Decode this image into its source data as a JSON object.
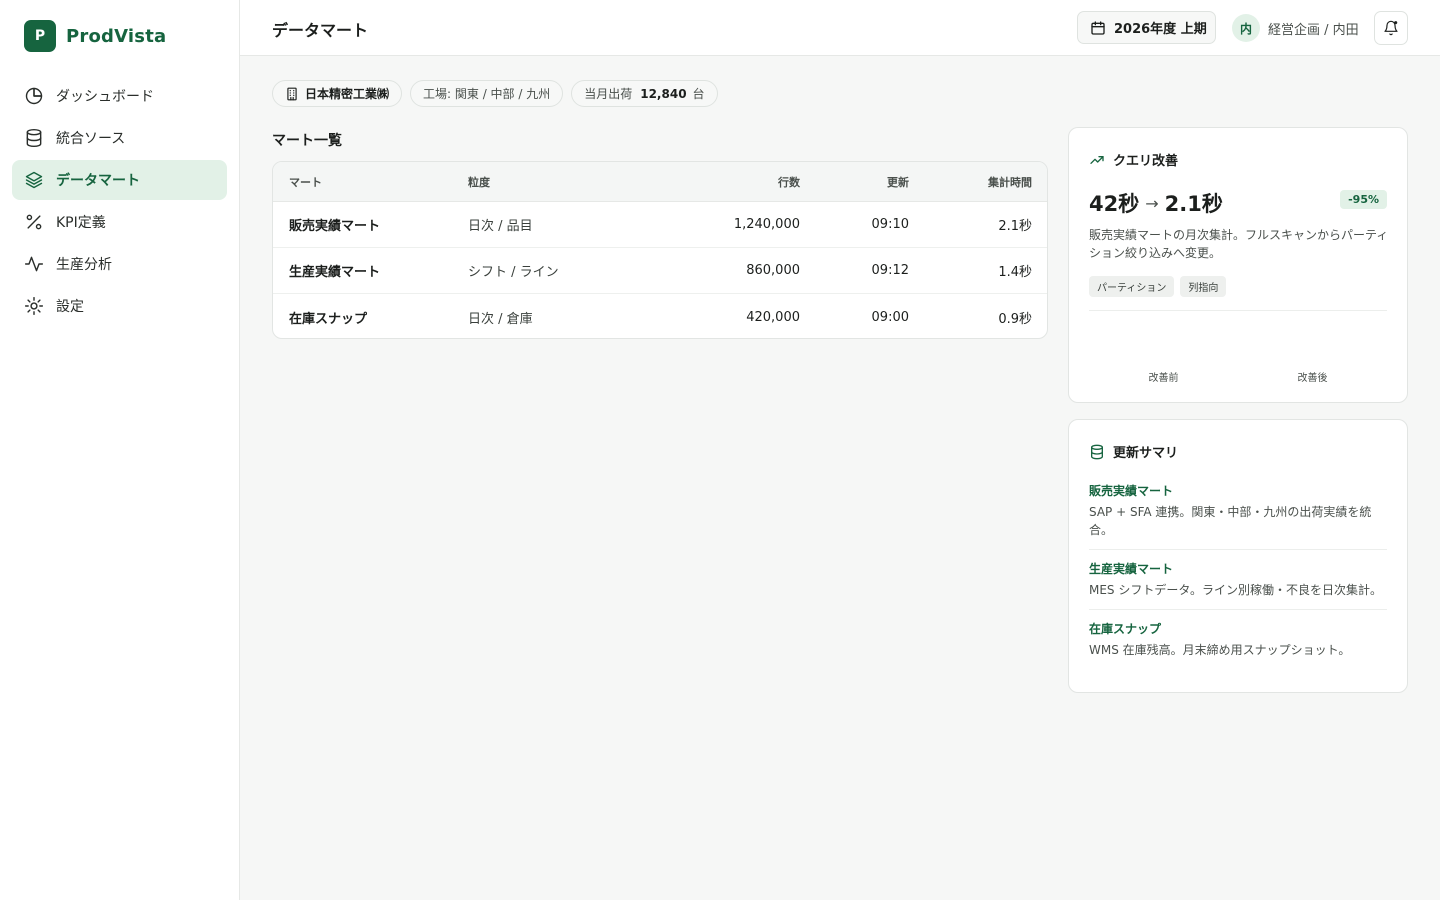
{
  "brand": {
    "logo_letter": "P",
    "name": "ProdVista",
    "color": "#16643f"
  },
  "sidebar": {
    "items": [
      {
        "label": "ダッシュボード",
        "icon": "pie-chart-icon",
        "active": false
      },
      {
        "label": "統合ソース",
        "icon": "database-icon",
        "active": false
      },
      {
        "label": "データマート",
        "icon": "layers-icon",
        "active": true
      },
      {
        "label": "KPI定義",
        "icon": "percent-icon",
        "active": false
      },
      {
        "label": "生産分析",
        "icon": "activity-icon",
        "active": false
      },
      {
        "label": "設定",
        "icon": "sun-gear-icon",
        "active": false
      }
    ]
  },
  "header": {
    "title": "データマート",
    "period": "2026年度 上期",
    "user_initial": "内",
    "user_name": "経営企画 / 内田"
  },
  "filters": {
    "company": "日本精密工業㈱",
    "plants": "工場: 関東 / 中部 / 九州",
    "shipment_label": "当月出荷",
    "shipment_value": "12,840",
    "shipment_unit": "台"
  },
  "mart_table": {
    "title": "マート一覧",
    "columns": [
      "マート",
      "粒度",
      "行数",
      "更新",
      "集計時間"
    ],
    "rows": [
      {
        "name": "販売実績マート",
        "grain": "日次 / 品目",
        "rows": "1,240,000",
        "updated": "09:10",
        "time": "2.1秒"
      },
      {
        "name": "生産実績マート",
        "grain": "シフト / ライン",
        "rows": "860,000",
        "updated": "09:12",
        "time": "1.4秒"
      },
      {
        "name": "在庫スナップ",
        "grain": "日次 / 倉庫",
        "rows": "420,000",
        "updated": "09:00",
        "time": "0.9秒"
      }
    ]
  },
  "query_card": {
    "title": "クエリ改善",
    "before": "42秒",
    "arrow": "→",
    "after": "2.1秒",
    "badge": "-95%",
    "description": "販売実績マートの月次集計。フルスキャンからパーティション絞り込みへ変更。",
    "tags": [
      "パーティション",
      "列指向"
    ],
    "chart_labels": [
      "改善前",
      "改善後"
    ]
  },
  "summary_card": {
    "title": "更新サマリ",
    "items": [
      {
        "title": "販売実績マート",
        "desc": "SAP + SFA 連携。関東・中部・九州の出荷実績を統合。"
      },
      {
        "title": "生産実績マート",
        "desc": "MES シフトデータ。ライン別稼働・不良を日次集計。"
      },
      {
        "title": "在庫スナップ",
        "desc": "WMS 在庫残高。月末締め用スナップショット。"
      }
    ]
  }
}
